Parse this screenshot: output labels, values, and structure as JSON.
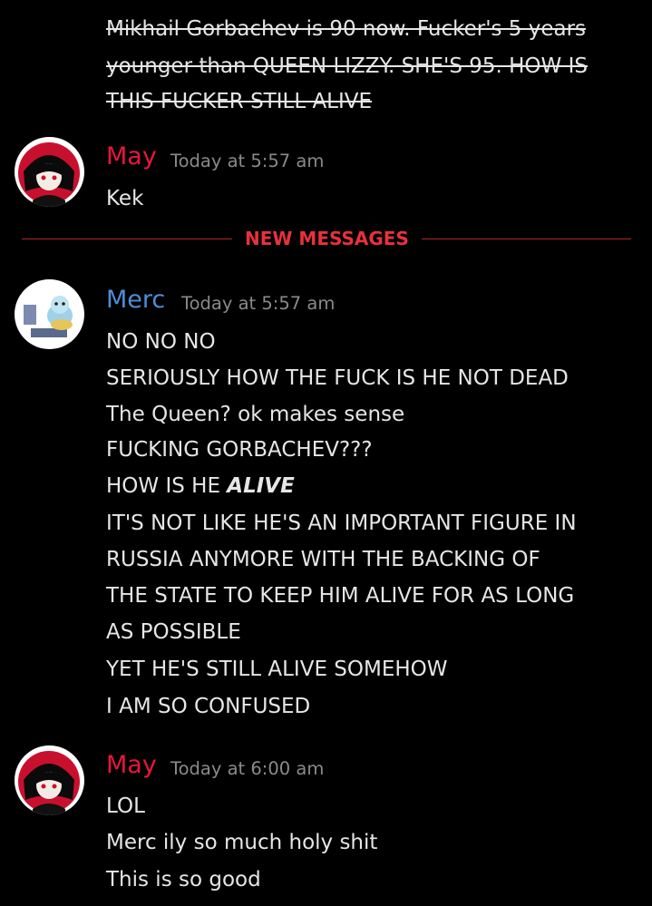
{
  "previous_message": {
    "lines": [
      "Mikhail Gorbachev is 90 now. Fucker's 5 years",
      "younger than QUEEN LIZZY. SHE'S 95. HOW IS",
      "THIS FUCKER STILL ALIVE"
    ]
  },
  "message_may_1": {
    "author": "May",
    "timestamp": "Today at 5:57 am",
    "lines": [
      "Kek"
    ]
  },
  "divider": {
    "label": "NEW MESSAGES",
    "color": "#e8313a"
  },
  "message_merc": {
    "author": "Merc",
    "timestamp": "Today at 5:57 am",
    "lines": [
      "NO NO NO",
      "SERIOUSLY HOW THE FUCK IS HE NOT DEAD",
      "The Queen? ok makes sense",
      "FUCKING GORBACHEV???",
      "HOW IS HE ",
      "IT'S NOT LIKE HE'S AN IMPORTANT FIGURE IN",
      "RUSSIA ANYMORE WITH THE BACKING OF",
      "THE STATE TO KEEP HIM ALIVE FOR AS LONG",
      "AS POSSIBLE",
      "YET HE'S STILL ALIVE SOMEHOW",
      "I AM SO CONFUSED"
    ],
    "emphasis": "ALIVE"
  },
  "message_may_2": {
    "author": "May",
    "timestamp": "Today at 6:00 am",
    "lines": [
      "LOL",
      "Merc ily so much holy shit",
      "This is so good"
    ]
  },
  "colors": {
    "background": "#000000",
    "may_name": "#e8163a",
    "merc_name": "#4c8ed6",
    "timestamp": "#8a8a8a",
    "text": "#e6e6e6"
  }
}
